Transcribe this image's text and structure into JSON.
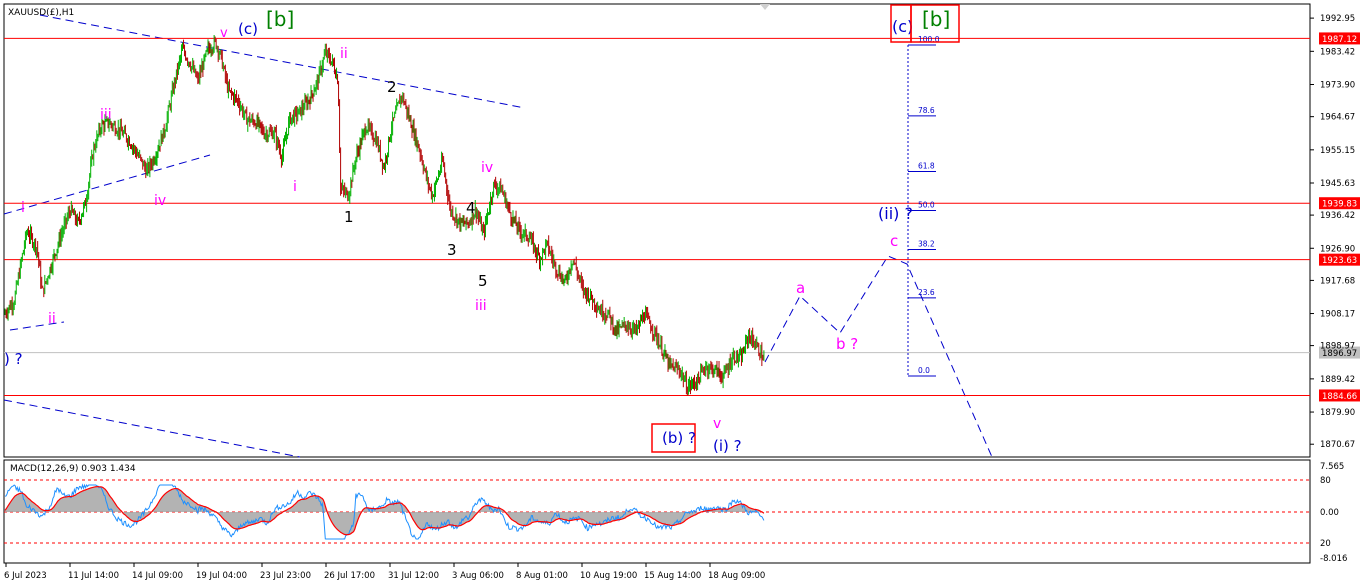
{
  "title": "XAUUSD(£),H1",
  "chart_data": [
    {
      "type": "candlestick",
      "symbol": "XAUUSD(£)",
      "timeframe": "H1",
      "ylim": [
        1867,
        1997
      ],
      "price_ticks": [
        "1992.95",
        "1983.42",
        "1973.90",
        "1964.67",
        "1955.15",
        "1945.63",
        "1936.42",
        "1926.90",
        "1917.68",
        "1908.17",
        "1898.97",
        "1889.42",
        "1879.90",
        "1870.67"
      ],
      "x_tick_labels": [
        "6 Jul 2023",
        "11 Jul 14:00",
        "14 Jul 09:00",
        "19 Jul 04:00",
        "23 Jul 23:00",
        "26 Jul 17:00",
        "31 Jul 12:00",
        "3 Aug 06:00",
        "8 Aug 01:00",
        "10 Aug 19:00",
        "15 Aug 14:00",
        "18 Aug 09:00"
      ],
      "price_path": [
        [
          0,
          1908
        ],
        [
          0.4,
          1912
        ],
        [
          0.9,
          1932
        ],
        [
          1.3,
          1927
        ],
        [
          1.5,
          1914
        ],
        [
          1.8,
          1921
        ],
        [
          2.2,
          1930
        ],
        [
          2.6,
          1938
        ],
        [
          2.9,
          1934
        ],
        [
          3.2,
          1940
        ],
        [
          3.5,
          1955
        ],
        [
          3.8,
          1962
        ],
        [
          4.1,
          1963
        ],
        [
          4.5,
          1961
        ],
        [
          4.9,
          1958
        ],
        [
          5.3,
          1953
        ],
        [
          5.6,
          1949
        ],
        [
          5.9,
          1953
        ],
        [
          6.3,
          1961
        ],
        [
          6.7,
          1975
        ],
        [
          7.0,
          1984
        ],
        [
          7.3,
          1980
        ],
        [
          7.6,
          1975
        ],
        [
          8.0,
          1984
        ],
        [
          8.3,
          1986
        ],
        [
          8.5,
          1982
        ],
        [
          8.8,
          1972
        ],
        [
          9.2,
          1969
        ],
        [
          9.5,
          1964
        ],
        [
          9.9,
          1963
        ],
        [
          10.2,
          1960
        ],
        [
          10.6,
          1960
        ],
        [
          10.9,
          1953
        ],
        [
          11.2,
          1964
        ],
        [
          11.6,
          1966
        ],
        [
          12.0,
          1970
        ],
        [
          12.3,
          1975
        ],
        [
          12.6,
          1983
        ],
        [
          12.9,
          1980
        ],
        [
          13.1,
          1975
        ],
        [
          13.2,
          1944
        ],
        [
          13.5,
          1942
        ],
        [
          13.8,
          1953
        ],
        [
          14.2,
          1962
        ],
        [
          14.6,
          1958
        ],
        [
          14.9,
          1950
        ],
        [
          15.2,
          1962
        ],
        [
          15.6,
          1971
        ],
        [
          15.9,
          1964
        ],
        [
          16.3,
          1955
        ],
        [
          16.6,
          1946
        ],
        [
          16.8,
          1942
        ],
        [
          17.2,
          1952
        ],
        [
          17.5,
          1938
        ],
        [
          17.9,
          1934
        ],
        [
          18.2,
          1934
        ],
        [
          18.5,
          1938
        ],
        [
          18.8,
          1931
        ],
        [
          19.2,
          1945
        ],
        [
          19.5,
          1944
        ],
        [
          19.9,
          1936
        ],
        [
          20.2,
          1932
        ],
        [
          20.6,
          1930
        ],
        [
          21.0,
          1924
        ],
        [
          21.3,
          1928
        ],
        [
          21.6,
          1922
        ],
        [
          22.0,
          1917
        ],
        [
          22.3,
          1924
        ],
        [
          22.7,
          1915
        ],
        [
          23.0,
          1913
        ],
        [
          23.4,
          1909
        ],
        [
          23.7,
          1908
        ],
        [
          24.0,
          1903
        ],
        [
          24.4,
          1905
        ],
        [
          24.8,
          1903
        ],
        [
          25.1,
          1908
        ],
        [
          25.5,
          1903
        ],
        [
          25.8,
          1898
        ],
        [
          26.1,
          1893
        ],
        [
          26.5,
          1892
        ],
        [
          26.8,
          1887
        ],
        [
          27.2,
          1889
        ],
        [
          27.5,
          1893
        ],
        [
          27.9,
          1892
        ],
        [
          28.2,
          1890
        ],
        [
          28.6,
          1896
        ],
        [
          28.9,
          1895
        ],
        [
          29.2,
          1902
        ],
        [
          29.5,
          1899
        ],
        [
          29.8,
          1895
        ]
      ],
      "horizontal_levels": [
        {
          "price": 1987.12,
          "label": "1987.12",
          "color": "#ff0000"
        },
        {
          "price": 1939.83,
          "label": "1939.83",
          "color": "#ff0000"
        },
        {
          "price": 1923.63,
          "label": "1923.63",
          "color": "#ff0000"
        },
        {
          "price": 1884.66,
          "label": "1884.66",
          "color": "#ff0000"
        },
        {
          "price": 1896.97,
          "label": "1896.97",
          "color": "#c0c0c0",
          "current": true
        }
      ],
      "fibonacci_levels": [
        "100.0",
        "78.6",
        "61.8",
        "50.0",
        "38.2",
        "23.6",
        "0.0"
      ],
      "wave_labels": [
        {
          "text": "v",
          "color": "#ff00ff"
        },
        {
          "text": "(c)",
          "color": "#0000cc"
        },
        {
          "text": "[b]",
          "color": "#008000"
        },
        {
          "text": "ii",
          "color": "#ff00ff"
        },
        {
          "text": "iii",
          "color": "#ff00ff"
        },
        {
          "text": "i",
          "color": "#ff00ff"
        },
        {
          "text": "iv",
          "color": "#ff00ff"
        },
        {
          "text": "i",
          "color": "#ff00ff"
        },
        {
          "text": "ii",
          "color": "#ff00ff"
        },
        {
          "text": "2",
          "color": "#000000"
        },
        {
          "text": "1",
          "color": "#000000"
        },
        {
          "text": "iv",
          "color": "#ff00ff"
        },
        {
          "text": "4",
          "color": "#000000"
        },
        {
          "text": "3",
          "color": "#000000"
        },
        {
          "text": "5",
          "color": "#000000"
        },
        {
          "text": "iii",
          "color": "#ff00ff"
        },
        {
          "text": "v",
          "color": "#ff00ff"
        },
        {
          "text": "(i) ?",
          "color": "#0000cc"
        },
        {
          "text": "(b) ?",
          "color": "#0000cc",
          "boxed": true
        },
        {
          "text": "a",
          "color": "#ff00ff"
        },
        {
          "text": "b ?",
          "color": "#ff00ff"
        },
        {
          "text": "c",
          "color": "#ff00ff"
        },
        {
          "text": "(ii) ?",
          "color": "#0000cc"
        },
        {
          "text": "(c)",
          "color": "#0000cc",
          "boxed": true
        },
        {
          "text": "[b]",
          "color": "#008000",
          "boxed": true
        },
        {
          "text": ") ?",
          "color": "#0000cc"
        }
      ],
      "projection_path_note": "a, b ?, c, then decline",
      "colors": {
        "up_candle": "#00b000",
        "down_candle": "#b00000",
        "level_line": "#ff0000",
        "trend_line": "#0000cc"
      }
    },
    {
      "type": "line",
      "indicator": "MACD",
      "label": "MACD(12,26,9) 0.903 1.434",
      "ticks": [
        "7.565",
        "80",
        "0.00",
        "20",
        "-8.016"
      ],
      "series": [
        {
          "color": "#1e90ff"
        },
        {
          "color": "#ff0000"
        },
        {
          "color": "#a0a0a0"
        }
      ]
    }
  ]
}
